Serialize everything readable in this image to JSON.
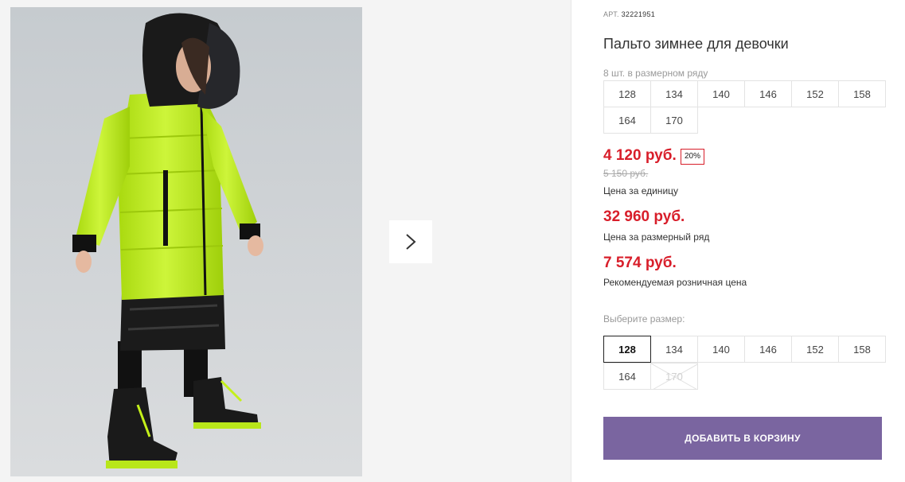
{
  "gallery": {
    "next_icon": "chevron-right-icon",
    "photo_alt": "girl-in-lime-winter-coat"
  },
  "product": {
    "art_label": "АРТ.",
    "art_value": "32221951",
    "title": "Пальто зимнее для девочки",
    "row_note": "8 шт. в размерном ряду",
    "row_sizes": [
      "128",
      "134",
      "140",
      "146",
      "152",
      "158",
      "164",
      "170"
    ],
    "price": "4 120 руб.",
    "discount": "20%",
    "old_price": "5 150 руб.",
    "price_caption": "Цена за единицу",
    "row_price": "32 960 руб.",
    "row_price_caption": "Цена за размерный ряд",
    "retail_price": "7 574 руб.",
    "retail_caption": "Рекомендуемая розничная цена",
    "choose_label": "Выберите размер:",
    "choose_sizes": [
      "128",
      "134",
      "140",
      "146",
      "152",
      "158",
      "164",
      "170"
    ],
    "selected_size": "128",
    "unavailable_size": "170",
    "add_to_cart": "ДОБАВИТЬ В КОРЗИНУ"
  },
  "colors": {
    "price_red": "#d81e2a",
    "button_purple": "#7a65a0",
    "coat_lime": "#c4f01a"
  }
}
